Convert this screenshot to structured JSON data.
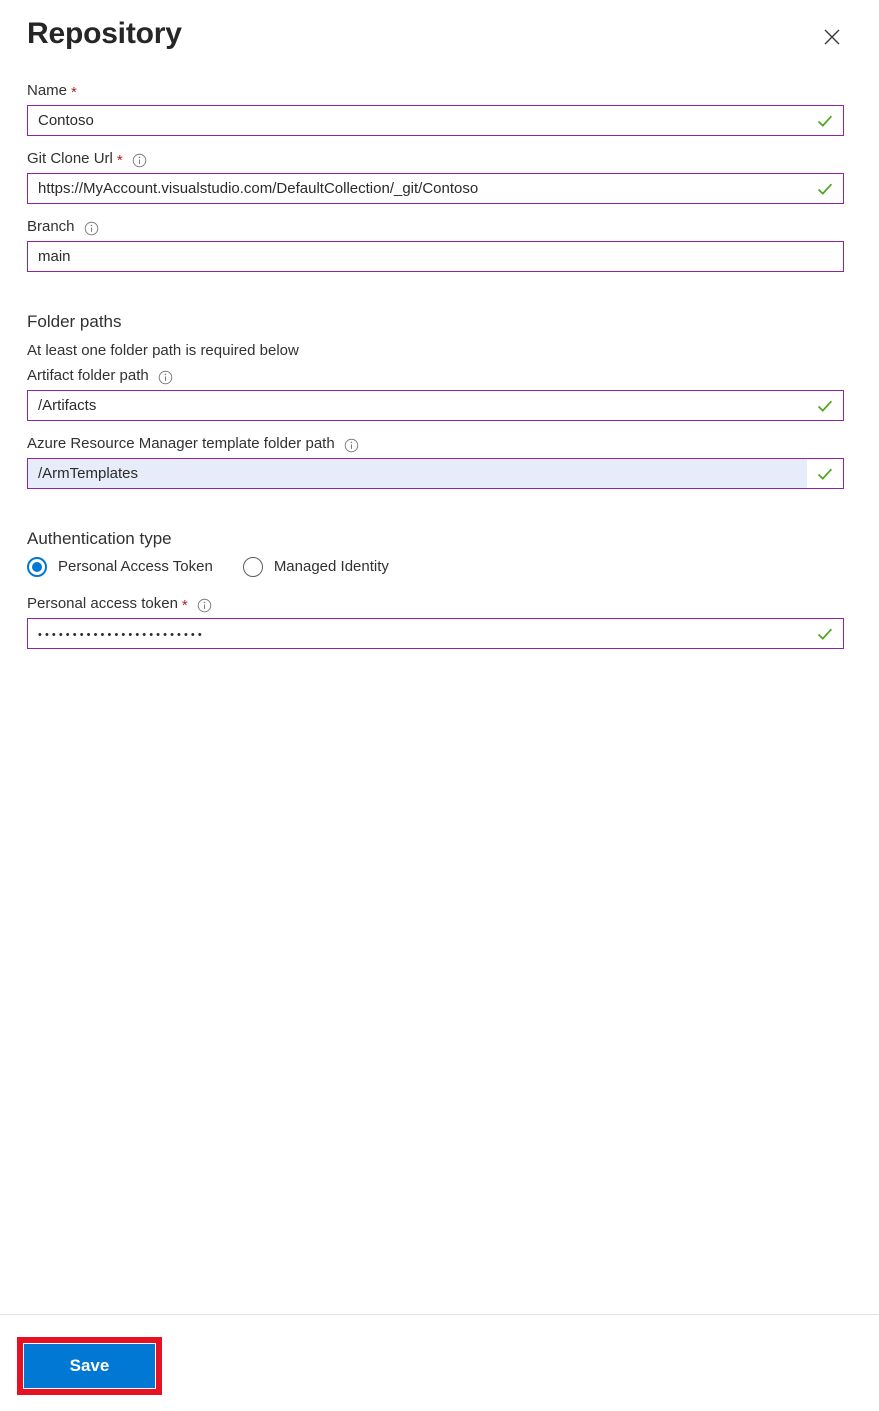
{
  "header": {
    "title": "Repository",
    "close_label": "Close"
  },
  "fields": {
    "name": {
      "label": "Name",
      "required": true,
      "value": "Contoso",
      "valid": true
    },
    "git_clone_url": {
      "label": "Git Clone Url",
      "required": true,
      "has_info": true,
      "value": "https://MyAccount.visualstudio.com/DefaultCollection/_git/Contoso",
      "valid": true
    },
    "branch": {
      "label": "Branch",
      "required": false,
      "has_info": true,
      "value": "main",
      "valid": false
    },
    "artifact_folder_path": {
      "label": "Artifact folder path",
      "required": false,
      "has_info": true,
      "value": "/Artifacts",
      "valid": true
    },
    "arm_template_folder_path": {
      "label": "Azure Resource Manager template folder path",
      "required": false,
      "has_info": true,
      "value": "/ArmTemplates",
      "valid": true,
      "focused": true
    },
    "personal_access_token": {
      "label": "Personal access token",
      "required": true,
      "has_info": true,
      "value": "••••••••••••••••••••••••",
      "valid": true
    }
  },
  "folder_paths_section": {
    "heading": "Folder paths",
    "helper": "At least one folder path is required below"
  },
  "auth_section": {
    "heading": "Authentication type",
    "options": [
      {
        "label": "Personal Access Token",
        "selected": true
      },
      {
        "label": "Managed Identity",
        "selected": false
      }
    ]
  },
  "footer": {
    "save_label": "Save"
  },
  "icons": {
    "info": "info-icon",
    "close": "close-icon",
    "check": "checkmark-icon"
  },
  "colors": {
    "accent_blue": "#0078d4",
    "field_border_purple": "#8d24a6",
    "valid_green": "#4ca521",
    "required_red": "#a4262c",
    "highlight_red": "#e81123",
    "focused_field_bg": "#e6ecf9"
  }
}
